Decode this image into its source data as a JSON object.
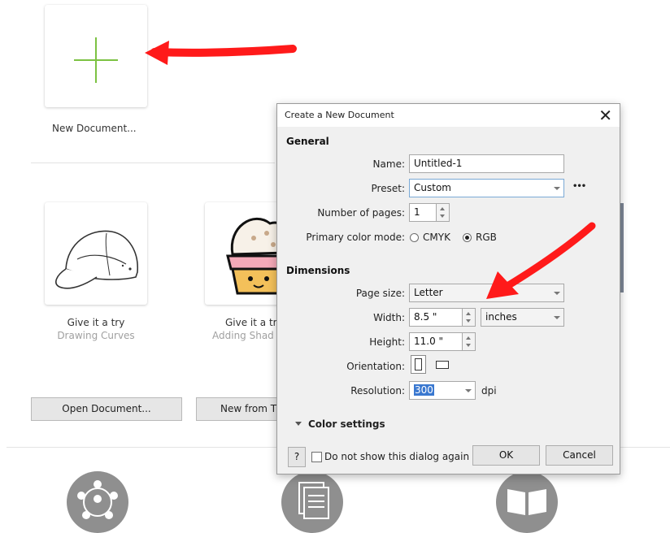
{
  "start": {
    "new_document_label": "New Document...",
    "tiles": [
      {
        "title": "Give it a try",
        "subtitle": "Drawing Curves"
      },
      {
        "title": "Give it a tr",
        "subtitle": "Adding Shad"
      }
    ],
    "open_document_label": "Open Document...",
    "new_from_template_label": "New from T",
    "bottom_icons": [
      "team-icon",
      "documents-icon",
      "book-icon"
    ]
  },
  "dialog": {
    "title": "Create a New Document",
    "close_glyph": "✕",
    "general": {
      "section_title": "General",
      "name_label": "Name:",
      "name_value": "Untitled-1",
      "preset_label": "Preset:",
      "preset_value": "Custom",
      "more_glyph": "•••",
      "pages_label": "Number of pages:",
      "pages_value": "1",
      "color_mode_label": "Primary color mode:",
      "color_mode_options": [
        "CMYK",
        "RGB"
      ],
      "color_mode_selected": "RGB"
    },
    "dimensions": {
      "section_title": "Dimensions",
      "page_size_label": "Page size:",
      "page_size_value": "Letter",
      "width_label": "Width:",
      "width_value": "8.5 \"",
      "units_value": "inches",
      "height_label": "Height:",
      "height_value": "11.0 \"",
      "orientation_label": "Orientation:",
      "orientation_selected": "portrait",
      "resolution_label": "Resolution:",
      "resolution_value": "300",
      "resolution_unit": "dpi"
    },
    "color_settings_label": "Color settings",
    "help_label": "?",
    "dont_show_label": "Do not show this dialog again",
    "ok_label": "OK",
    "cancel_label": "Cancel"
  },
  "colors": {
    "annotation_red": "#ff1a1a",
    "plus_green": "#7cc243",
    "selection_blue": "#3a78d0"
  }
}
